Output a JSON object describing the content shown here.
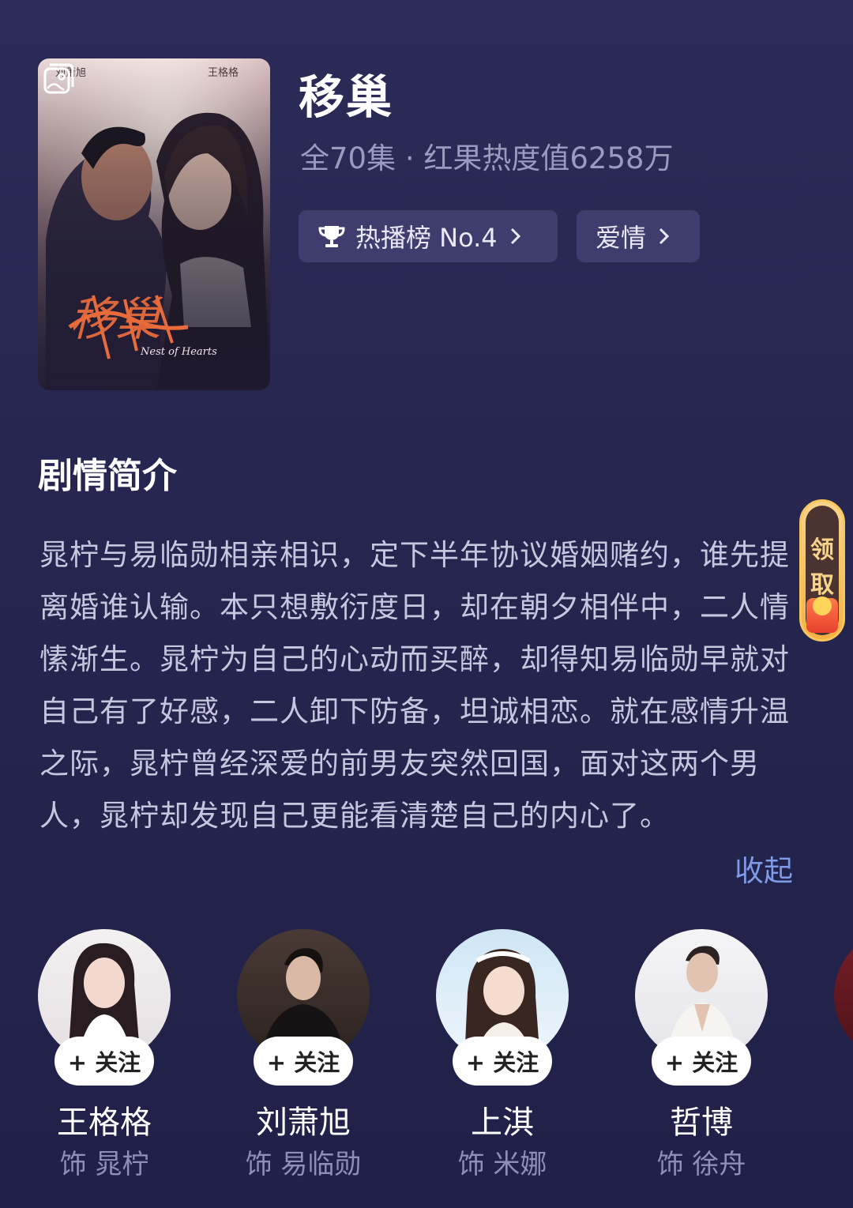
{
  "drama": {
    "title": "移巢",
    "meta": "全70集 · 红果热度值6258万",
    "poster_alt": "移巢 poster",
    "poster_text": {
      "actor_left": "刘萧旭",
      "actor_right": "王格格",
      "calligraphy": "移巢",
      "english": "Nest of Hearts"
    }
  },
  "tags": [
    {
      "label": "热播榜 No.4",
      "icon": "trophy-icon"
    },
    {
      "label": "爱情"
    }
  ],
  "synopsis": {
    "heading": "剧情简介",
    "text": "晁柠与易临勋相亲相识，定下半年协议婚姻赌约，谁先提离婚谁认输。本只想敷衍度日，却在朝夕相伴中，二人情愫渐生。晁柠为自己的心动而买醉，却得知易临勋早就对自己有了好感，二人卸下防备，坦诚相恋。就在感情升温之际，晁柠曾经深爱的前男友突然回国，面对这两个男人，晁柠却发现自己更能看清楚自己的内心了。",
    "collapse_label": "收起"
  },
  "reward": {
    "line1": "领",
    "line2": "取"
  },
  "cast": [
    {
      "name": "王格格",
      "role": "饰 晁柠",
      "follow": "+ 关注"
    },
    {
      "name": "刘萧旭",
      "role": "饰 易临勋",
      "follow": "+ 关注"
    },
    {
      "name": "上淇",
      "role": "饰 米娜",
      "follow": "+ 关注"
    },
    {
      "name": "哲博",
      "role": "饰 徐舟",
      "follow": "+ 关注"
    }
  ],
  "colors": {
    "background": "#25264f",
    "accent_link": "#7d9be6",
    "tag_bg": "#3e3d6d"
  }
}
